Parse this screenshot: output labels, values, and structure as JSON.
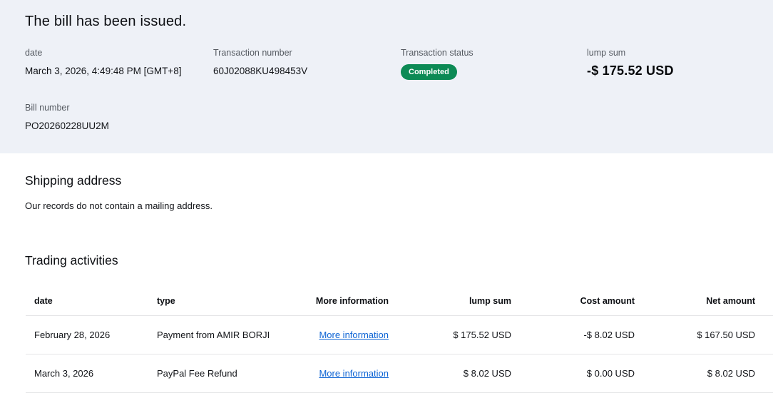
{
  "colors": {
    "header_background": "#eef1f7",
    "status_badge_green": "#0c8a55",
    "link_blue": "#0c63d4",
    "divider_gray": "#e4e5e7"
  },
  "header": {
    "title": "The bill has been issued.",
    "fields": [
      {
        "label": "date",
        "value": "March 3, 2026, 4:49:48 PM [GMT+8]"
      },
      {
        "label": "Transaction number",
        "value": "60J02088KU498453V"
      },
      {
        "label": "Transaction status",
        "value": "Completed"
      },
      {
        "label": "lump sum",
        "value": "-$ 175.52 USD"
      },
      {
        "label": "Bill number",
        "value": "PO20260228UU2M"
      }
    ]
  },
  "shipping": {
    "title": "Shipping address",
    "message": "Our records do not contain a mailing address."
  },
  "trading": {
    "title": "Trading activities",
    "columns": [
      "date",
      "type",
      "More information",
      "lump sum",
      "Cost amount",
      "Net amount"
    ],
    "rows": [
      {
        "date": "February 28, 2026",
        "type": "Payment from AMIR BORJI",
        "more_info": "More information",
        "lump_sum": "$ 175.52 USD",
        "cost_amount": "-$ 8.02 USD",
        "net_amount": "$ 167.50 USD"
      },
      {
        "date": "March 3, 2026",
        "type": "PayPal Fee Refund",
        "more_info": "More information",
        "lump_sum": "$ 8.02 USD",
        "cost_amount": "$ 0.00 USD",
        "net_amount": "$ 8.02 USD"
      }
    ]
  }
}
